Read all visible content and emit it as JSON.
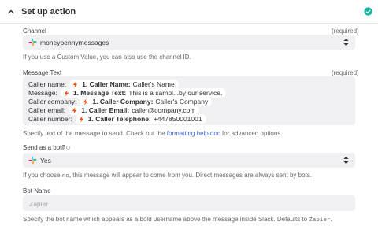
{
  "header": {
    "title": "Set up action"
  },
  "channel": {
    "label": "Channel",
    "required": "(required)",
    "value": "moneypennymessages",
    "help": "If you use a Custom Value, you can also use the channel ID."
  },
  "message_text": {
    "label": "Message Text",
    "required": "(required)",
    "lines": [
      {
        "prefix": "Caller name:",
        "field": "1. Caller Name:",
        "value": "Caller's Name"
      },
      {
        "prefix": "Message:",
        "field": "1. Message Text:",
        "value": "This is a sampl...by our service."
      },
      {
        "prefix": "Caller company:",
        "field": "1. Caller Company:",
        "value": "Caller's Company"
      },
      {
        "prefix": "Caller email:",
        "field": "1. Caller Email:",
        "value": "caller@company.com"
      },
      {
        "prefix": "Caller number:",
        "field": "1. Caller Telephone:",
        "value": "+447850001001"
      }
    ],
    "help_before": "Specify text of the message to send. Check out the ",
    "help_link": "formatting help doc",
    "help_after": " for advanced options."
  },
  "send_as_bot": {
    "label": "Send as a bot?",
    "value": "Yes",
    "help_1": "If you choose ",
    "help_code": "no",
    "help_2": ", this message will appear to come from you. Direct messages are always sent by bots."
  },
  "bot_name": {
    "label": "Bot Name",
    "placeholder": "Zapier",
    "help_1": "Specify the bot name which appears as a bold username above the message inside Slack. Defaults to ",
    "help_code": "Zapier",
    "help_2": "."
  },
  "colors": {
    "success": "#13b5a1",
    "link": "#3d5fd1",
    "field_bg": "#f0f0f2",
    "zapier_orange": "#ff4a00"
  },
  "icons": [
    "chevron-up-icon",
    "success-check-icon",
    "slack-icon",
    "updown-icon",
    "zapier-icon"
  ]
}
